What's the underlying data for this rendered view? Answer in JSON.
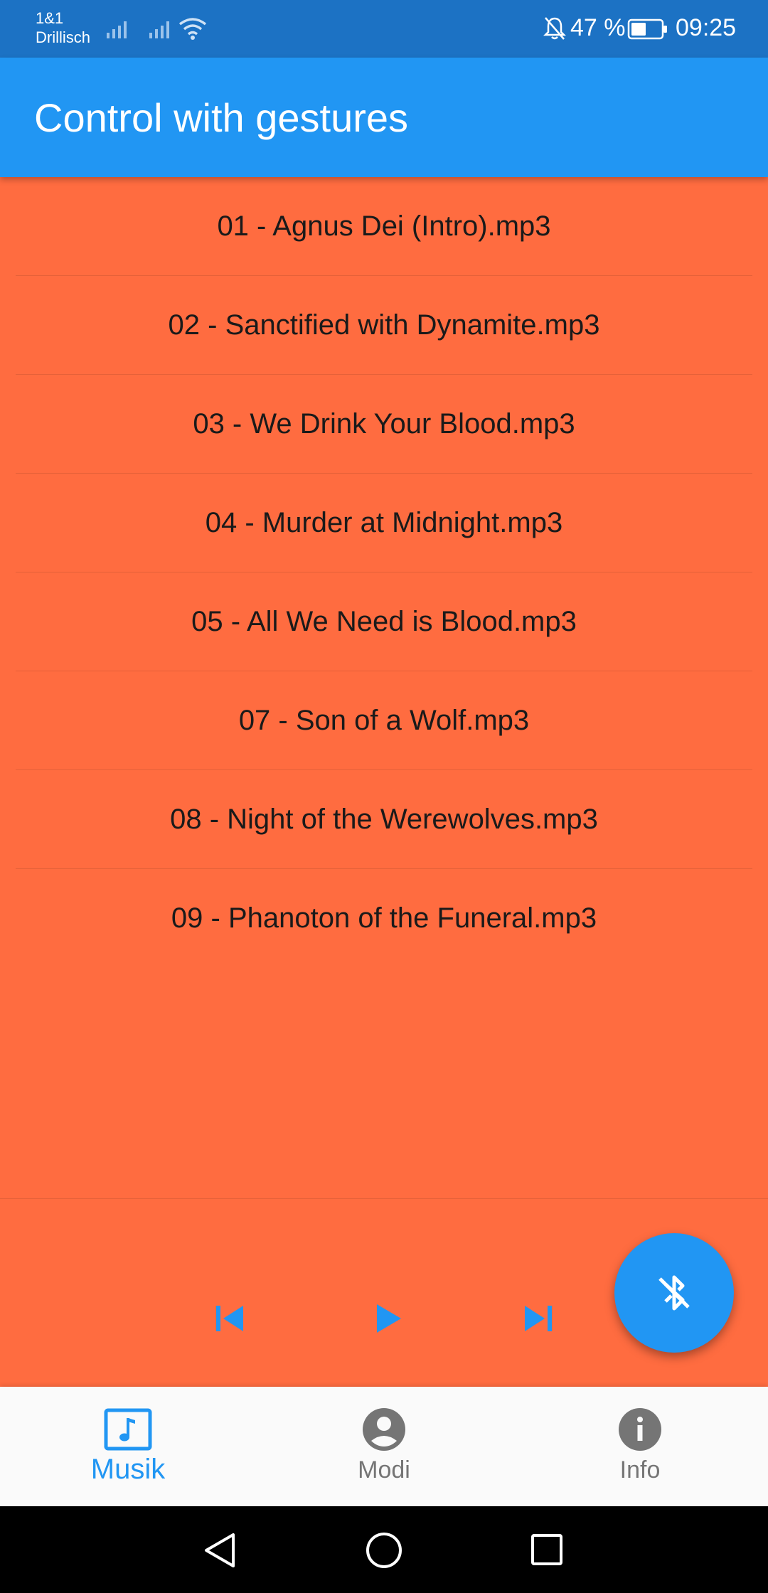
{
  "status_bar": {
    "carrier_line1": "1&1",
    "carrier_line2": "Drillisch",
    "battery_percent": "47 %",
    "time": "09:25",
    "icons": [
      "signal-icon",
      "signal-icon",
      "wifi-icon",
      "bell-off-icon",
      "battery-icon"
    ]
  },
  "app_bar": {
    "title": "Control with gestures"
  },
  "tracks": [
    "01 - Agnus Dei (Intro).mp3",
    "02 - Sanctified with Dynamite.mp3",
    "03 - We Drink Your Blood.mp3",
    "04 - Murder at Midnight.mp3",
    "05 - All We Need is Blood.mp3",
    "07 - Son of a Wolf.mp3",
    "08 - Night of the Werewolves.mp3",
    "09 - Phanoton of the Funeral.mp3"
  ],
  "player": {
    "controls": [
      "skip-previous-icon",
      "play-icon",
      "skip-next-icon"
    ],
    "fab_icon": "bluetooth-disabled-icon"
  },
  "bottom_nav": {
    "items": [
      {
        "label": "Musik",
        "icon": "music-note-icon",
        "active": true
      },
      {
        "label": "Modi",
        "icon": "account-circle-icon",
        "active": false
      },
      {
        "label": "Info",
        "icon": "info-icon",
        "active": false
      }
    ]
  },
  "colors": {
    "status_bar": "#1c72c4",
    "app_bar": "#2196f3",
    "accent": "#2196f3",
    "background": "#ff6c40",
    "nav_background": "#fafafa",
    "inactive": "#757575"
  }
}
